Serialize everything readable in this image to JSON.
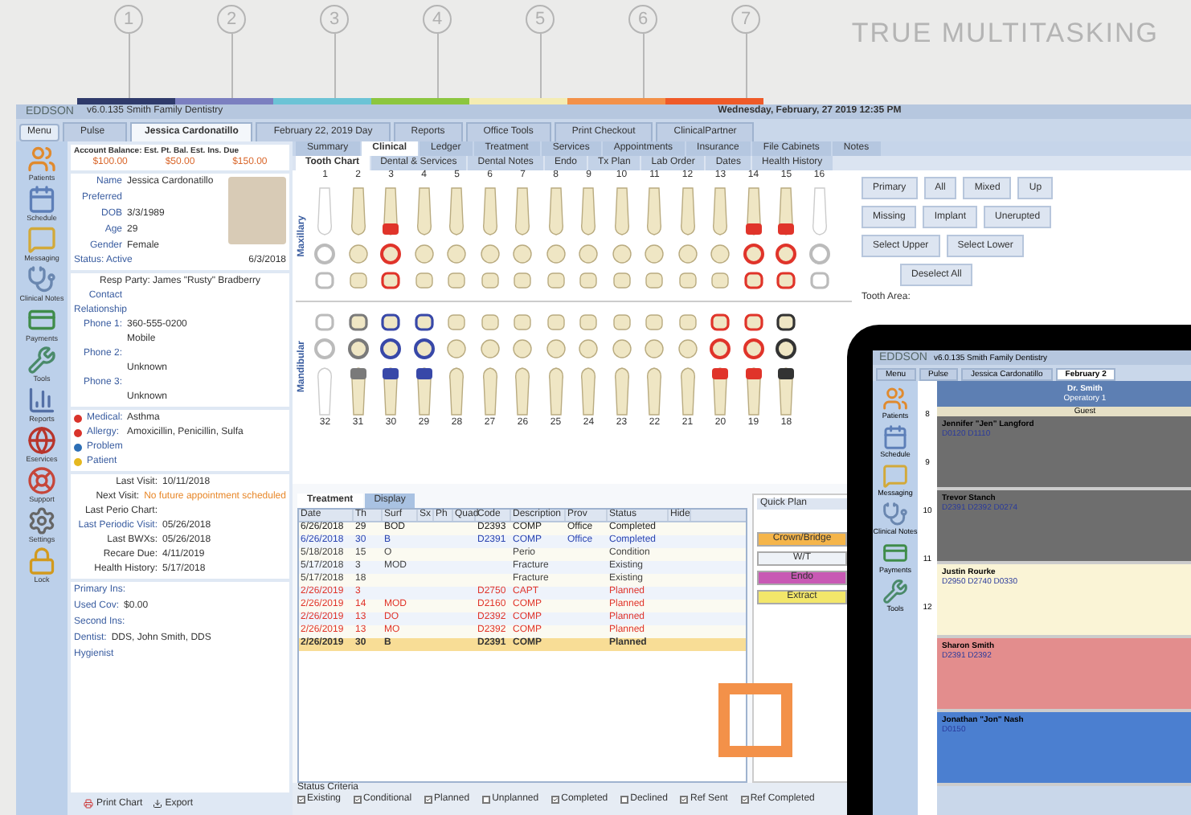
{
  "header": {
    "steps": [
      {
        "number": "1",
        "color": "#2f3a6b"
      },
      {
        "number": "2",
        "color": "#7b7fc0"
      },
      {
        "number": "3",
        "color": "#6cc3d6"
      },
      {
        "number": "4",
        "color": "#8cc63f"
      },
      {
        "number": "5",
        "color": "#f4ecb2"
      },
      {
        "number": "6",
        "color": "#f39149"
      },
      {
        "number": "7",
        "color": "#ef5a28"
      }
    ],
    "tagline": "TRUE MULTITASKING"
  },
  "app": {
    "logo": "EDDSON",
    "version": "v6.0.135  Smith Family Dentistry",
    "datetime": "Wednesday, February, 27 2019 12:35 PM",
    "menu": "Menu",
    "top_tabs": [
      {
        "label": "Pulse",
        "selected": false
      },
      {
        "label": "Jessica Cardonatillo",
        "selected": true
      },
      {
        "label": "February 22, 2019 Day",
        "selected": false
      },
      {
        "label": "Reports",
        "selected": false
      },
      {
        "label": "Office Tools",
        "selected": false
      },
      {
        "label": "Print Checkout",
        "selected": false
      },
      {
        "label": "ClinicalPartner",
        "selected": false
      }
    ],
    "sidebar": [
      "Patients",
      "Schedule",
      "Messaging",
      "Clinical Notes",
      "Payments",
      "Tools",
      "Reports",
      "Eservices",
      "Support",
      "Settings",
      "Lock"
    ],
    "patient": {
      "balance_label": "Account Balance: Est. Pt. Bal. Est. Ins. Due",
      "balances": [
        "$100.00",
        "$50.00",
        "$150.00"
      ],
      "fields": [
        {
          "label": "Name",
          "value": "Jessica Cardonatillo"
        },
        {
          "label": "Preferred"
        },
        {
          "label": "DOB",
          "value": "3/3/1989"
        },
        {
          "label": "Age",
          "value": "29"
        },
        {
          "label": "Gender",
          "value": "Female"
        }
      ],
      "status_label": "Status: Active",
      "status_date": "6/3/2018",
      "resp_party": "Resp Party: James \"Rusty\" Bradberry",
      "contact": [
        {
          "label": "Contact"
        },
        {
          "label": "Relationship"
        },
        {
          "label": "Phone 1:",
          "value": "360-555-0200"
        },
        {
          "value": "Mobile"
        },
        {
          "label": "Phone 2:"
        },
        {
          "value": "Unknown"
        },
        {
          "label": "Phone 3:"
        },
        {
          "value": "Unknown"
        }
      ],
      "alerts": [
        {
          "label": "Medical:",
          "value": "Asthma",
          "color": "#d9332b"
        },
        {
          "label": "Allergy:",
          "value": "Amoxicillin, Penicillin, Sulfa",
          "color": "#d9332b"
        },
        {
          "label": "Problem",
          "color": "#2d6fb6"
        },
        {
          "label": "Patient",
          "color": "#e5b820"
        }
      ],
      "visits": [
        {
          "label": "Last Visit:",
          "value": "10/11/2018",
          "kind": "plain"
        },
        {
          "label": "Next Visit:",
          "value": "No future appointment scheduled",
          "kind": "alert"
        },
        {
          "label": "Last Perio Chart:",
          "kind": "plain"
        },
        {
          "label": "Last Periodic Visit:",
          "value": "05/26/2018",
          "kind": "link"
        },
        {
          "label": "Last BWXs:",
          "value": "05/26/2018",
          "kind": "plain"
        },
        {
          "label": "Recare Due:",
          "value": "4/11/2019",
          "kind": "plain"
        },
        {
          "label": "Health History:",
          "value": "5/17/2018",
          "kind": "plain"
        }
      ],
      "insurance": [
        {
          "label": "Primary Ins:"
        },
        {
          "label": "Used Cov:",
          "value": "$0.00"
        },
        {
          "label": "Second Ins:"
        },
        {
          "label": "Dentist:",
          "value": "DDS, John Smith, DDS"
        },
        {
          "label": "Hygienist"
        }
      ],
      "footer": [
        "Print Chart",
        "Export"
      ]
    },
    "section_tabs": [
      {
        "label": "Summary",
        "selected": false
      },
      {
        "label": "Clinical",
        "selected": true
      },
      {
        "label": "Ledger",
        "selected": false
      },
      {
        "label": "Treatment",
        "selected": false
      },
      {
        "label": "Services",
        "selected": false
      },
      {
        "label": "Appointments",
        "selected": false
      },
      {
        "label": "Insurance",
        "selected": false
      },
      {
        "label": "File Cabinets",
        "selected": false
      },
      {
        "label": "Notes",
        "selected": false
      }
    ],
    "clinical_tabs": [
      {
        "label": "Tooth Chart",
        "selected": true
      },
      {
        "label": "Dental & Services",
        "selected": false
      },
      {
        "label": "Dental Notes",
        "selected": false
      },
      {
        "label": "Endo",
        "selected": false
      },
      {
        "label": "Tx Plan",
        "selected": false
      },
      {
        "label": "Lab Order",
        "selected": false
      },
      {
        "label": "Dates",
        "selected": false
      },
      {
        "label": "Health History",
        "selected": false
      }
    ],
    "arch_labels": [
      "Maxillary",
      "Mandibular"
    ],
    "upper_teeth": [
      {
        "number": "1",
        "kind": "missing"
      },
      {
        "number": "2",
        "kind": "none"
      },
      {
        "number": "3",
        "kind": "planned"
      },
      {
        "number": "4",
        "kind": "none"
      },
      {
        "number": "5",
        "kind": "none"
      },
      {
        "number": "6",
        "kind": "none"
      },
      {
        "number": "7",
        "kind": "none"
      },
      {
        "number": "8",
        "kind": "none"
      },
      {
        "number": "9",
        "kind": "none"
      },
      {
        "number": "10",
        "kind": "none"
      },
      {
        "number": "11",
        "kind": "none"
      },
      {
        "number": "12",
        "kind": "none"
      },
      {
        "number": "13",
        "kind": "none"
      },
      {
        "number": "14",
        "kind": "planned"
      },
      {
        "number": "15",
        "kind": "planned"
      },
      {
        "number": "16",
        "kind": "missing"
      }
    ],
    "lower_teeth": [
      {
        "number": "32",
        "kind": "missing"
      },
      {
        "number": "31",
        "kind": "existing"
      },
      {
        "number": "30",
        "kind": "completed"
      },
      {
        "number": "29",
        "kind": "completed"
      },
      {
        "number": "28",
        "kind": "none"
      },
      {
        "number": "27",
        "kind": "none"
      },
      {
        "number": "26",
        "kind": "none"
      },
      {
        "number": "25",
        "kind": "none"
      },
      {
        "number": "24",
        "kind": "none"
      },
      {
        "number": "23",
        "kind": "none"
      },
      {
        "number": "22",
        "kind": "none"
      },
      {
        "number": "21",
        "kind": "none"
      },
      {
        "number": "20",
        "kind": "planned"
      },
      {
        "number": "19",
        "kind": "planned"
      },
      {
        "number": "18",
        "kind": "bridge"
      }
    ],
    "chart_buttons": [
      [
        "Primary",
        "All",
        "Mixed",
        "Up"
      ],
      [
        "Missing",
        "Implant",
        "Unerupted"
      ],
      [
        "Select Upper",
        "Select Lower"
      ],
      [
        "Deselect All"
      ]
    ],
    "tooth_area": "Tooth Area:",
    "list_tabs": [
      {
        "label": "Treatment",
        "selected": true
      },
      {
        "label": "Display",
        "selected": false
      }
    ],
    "columns": [
      "Date",
      "Th",
      "Surf",
      "Sx",
      "Ph",
      "Quad",
      "Code",
      "Description",
      "Prov",
      "Status",
      "Hide"
    ],
    "rows": [
      {
        "cells": [
          "6/26/2018",
          "29",
          "BOD",
          "",
          "",
          "",
          "D2393",
          "COMP",
          "Office",
          "Completed"
        ],
        "kind": "completed",
        "selected": false
      },
      {
        "cells": [
          "6/26/2018",
          "30",
          "B",
          "",
          "",
          "",
          "D2391",
          "COMP",
          "Office",
          "Completed"
        ],
        "kind": "completed",
        "selected": false
      },
      {
        "cells": [
          "5/18/2018",
          "15",
          "O",
          "",
          "",
          "",
          "",
          "Perio",
          "",
          "Condition"
        ],
        "kind": "existing",
        "selected": false
      },
      {
        "cells": [
          "5/17/2018",
          "3",
          "MOD",
          "",
          "",
          "",
          "",
          "Fracture",
          "",
          "Existing"
        ],
        "kind": "existing",
        "selected": false
      },
      {
        "cells": [
          "5/17/2018",
          "18",
          "",
          "",
          "",
          "",
          "",
          "Fracture",
          "",
          "Existing"
        ],
        "kind": "existing",
        "selected": false
      },
      {
        "cells": [
          "2/26/2019",
          "3",
          "",
          "",
          "",
          "",
          "D2750",
          "CAPT",
          "",
          "Planned"
        ],
        "kind": "planned",
        "selected": false
      },
      {
        "cells": [
          "2/26/2019",
          "14",
          "MOD",
          "",
          "",
          "",
          "D2160",
          "COMP",
          "",
          "Planned"
        ],
        "kind": "planned",
        "selected": false
      },
      {
        "cells": [
          "2/26/2019",
          "13",
          "DO",
          "",
          "",
          "",
          "D2392",
          "COMP",
          "",
          "Planned"
        ],
        "kind": "planned",
        "selected": false
      },
      {
        "cells": [
          "2/26/2019",
          "13",
          "MO",
          "",
          "",
          "",
          "D2392",
          "COMP",
          "",
          "Planned"
        ],
        "kind": "planned",
        "selected": false
      },
      {
        "cells": [
          "2/26/2019",
          "30",
          "B",
          "",
          "",
          "",
          "D2391",
          "COMP",
          "",
          "Planned"
        ],
        "kind": "planned",
        "selected": true
      }
    ],
    "quick_plan": {
      "title": "Quick Plan",
      "buttons": [
        {
          "label": "Crown/Bridge",
          "color": "#f5b54a"
        },
        {
          "label": "W/T",
          "color": "#eef2f7"
        },
        {
          "label": "Endo",
          "color": "#c859b4"
        },
        {
          "label": "Extract",
          "color": "#f3e76a"
        }
      ]
    },
    "status_title": "Status Criteria",
    "status_filters": [
      {
        "label": "Existing",
        "checked": true
      },
      {
        "label": "Conditional",
        "checked": true
      },
      {
        "label": "Planned",
        "checked": true
      },
      {
        "label": "Unplanned",
        "checked": false
      },
      {
        "label": "Completed",
        "checked": true
      },
      {
        "label": "Declined",
        "checked": false
      },
      {
        "label": "Ref Sent",
        "checked": true
      },
      {
        "label": "Ref Completed",
        "checked": true
      }
    ]
  },
  "tablet": {
    "logo": "EDDSON",
    "version": "v6.0.135  Smith Family Dentistry",
    "tabs": [
      {
        "label": "Menu",
        "selected": false
      },
      {
        "label": "Pulse",
        "selected": false
      },
      {
        "label": "Jessica Cardonatillo",
        "selected": false
      },
      {
        "label": "February 2",
        "selected": true
      }
    ],
    "sidebar": [
      "Patients",
      "Schedule",
      "Messaging",
      "Clinical Notes",
      "Payments",
      "Tools"
    ],
    "column_header": [
      "Dr. Smith",
      "Operatory 1"
    ],
    "column_sub": "Guest",
    "hours": [
      "8",
      "9",
      "10",
      "11",
      "12"
    ],
    "appointments": [
      {
        "name": "Jennifer \"Jen\" Langford",
        "detail": "D0120 D1110",
        "color": "#6e6e6e"
      },
      {
        "name": "Trevor Stanch",
        "detail": "D2391 D2392 D0274",
        "color": "#6e6e6e"
      },
      {
        "name": "Justin Rourke",
        "detail": "D2950 D2740 D0330",
        "color": "#faf4d6"
      },
      {
        "name": "Sharon Smith",
        "detail": "D2391 D2392",
        "color": "#e38d8d"
      },
      {
        "name": "Jonathan \"Jon\" Nash",
        "detail": "D0150",
        "color": "#4b7fd0"
      }
    ]
  }
}
